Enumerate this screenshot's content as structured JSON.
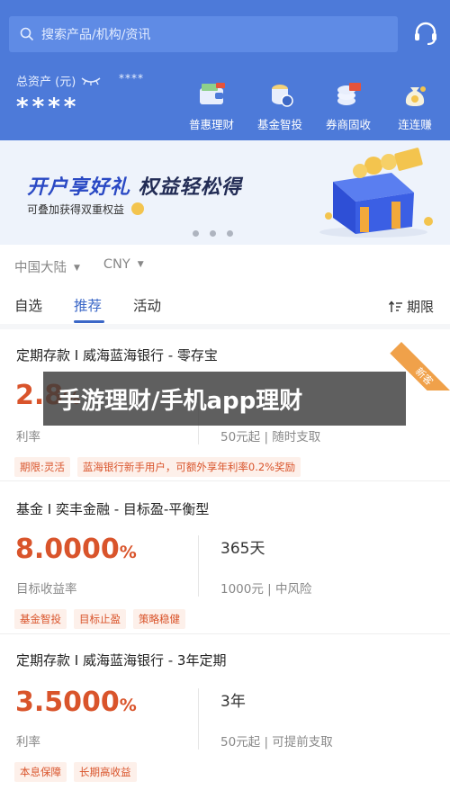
{
  "header": {
    "search_placeholder": "搜索产品/机构/资讯",
    "total_assets_label": "总资产 (元)",
    "assets_mask_small": "****",
    "assets_mask": "****",
    "quick_links": [
      {
        "label": "普惠理财",
        "icon": "wallet-icon"
      },
      {
        "label": "基金智投",
        "icon": "coins-stack-icon"
      },
      {
        "label": "券商固收",
        "icon": "coupon-coins-icon"
      },
      {
        "label": "连连赚",
        "icon": "money-bag-icon"
      }
    ]
  },
  "banner": {
    "title_part1": "开户享好礼",
    "title_part2": "权益轻松得",
    "subtitle": "可叠加获得双重权益"
  },
  "filter": {
    "region": "中国大陆",
    "currency": "CNY"
  },
  "tabs": [
    "自选",
    "推荐",
    "活动"
  ],
  "active_tab": "推荐",
  "term_filter_label": "期限",
  "overlay_title": "手游理财/手机app理财",
  "corner_badge": "新客",
  "products": [
    {
      "title": "定期存款 I 威海蓝海银行 - 零存宝",
      "rate": "2.8",
      "rate_suffix": "%",
      "rate_label": "利率",
      "term": "",
      "term_meta": "50元起 | 随时支取",
      "tags": [
        "期限:灵活",
        "蓝海银行新手用户，可额外享年利率0.2%奖励"
      ]
    },
    {
      "title": "基金 I 奕丰金融 - 目标盈-平衡型",
      "rate": "8.0000",
      "rate_suffix": "%",
      "rate_label": "目标收益率",
      "term": "365天",
      "term_meta": "1000元 | 中风险",
      "tags": [
        "基金智投",
        "目标止盈",
        "策略稳健"
      ]
    },
    {
      "title": "定期存款 I 威海蓝海银行 - 3年定期",
      "rate": "3.5000",
      "rate_suffix": "%",
      "rate_label": "利率",
      "term": "3年",
      "term_meta": "50元起 | 可提前支取",
      "tags": [
        "本息保障",
        "长期高收益"
      ]
    }
  ],
  "colors": {
    "header_blue": "#4d7ad9",
    "accent_blue": "#3b67c7",
    "rate_orange": "#d9542b",
    "tag_bg": "#fdf0ea"
  }
}
